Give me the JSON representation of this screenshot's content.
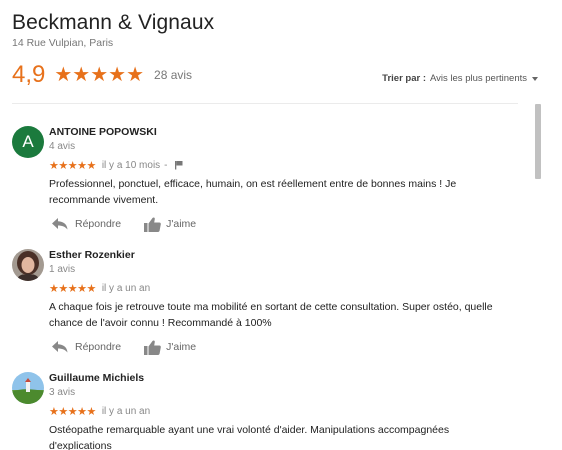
{
  "business": {
    "name": "Beckmann & Vignaux",
    "address": "14 Rue Vulpian, Paris",
    "rating": "4,9",
    "stars": "★★★★★",
    "review_count": "28 avis"
  },
  "sort": {
    "label": "Trier par :",
    "value": "Avis les plus pertinents"
  },
  "reviews": [
    {
      "avatar_letter": "A",
      "name": "ANTOINE POPOWSKI",
      "count": "4 avis",
      "stars": "★★★★★",
      "date": "il y a 10 mois",
      "dash": "-",
      "text": "Professionnel, ponctuel, efficace, humain, on est réellement entre de bonnes mains ! Je recommande vivement.",
      "reply_label": "Répondre",
      "like_label": "J'aime"
    },
    {
      "name": "Esther Rozenkier",
      "count": "1 avis",
      "stars": "★★★★★",
      "date": "il y a un an",
      "text": "A chaque fois je retrouve toute ma mobilité en sortant de cette consultation. Super ostéo, quelle chance de l'avoir connu ! Recommandé à 100%",
      "reply_label": "Répondre",
      "like_label": "J'aime"
    },
    {
      "name": "Guillaume Michiels",
      "count": "3 avis",
      "stars": "★★★★★",
      "date": "il y a un an",
      "text": "Ostéopathe remarquable ayant une vrai volonté d'aider. Manipulations accompagnées d'explications"
    }
  ],
  "colors": {
    "star": "#e7711b",
    "avatar_green": "#1b7a3d"
  }
}
